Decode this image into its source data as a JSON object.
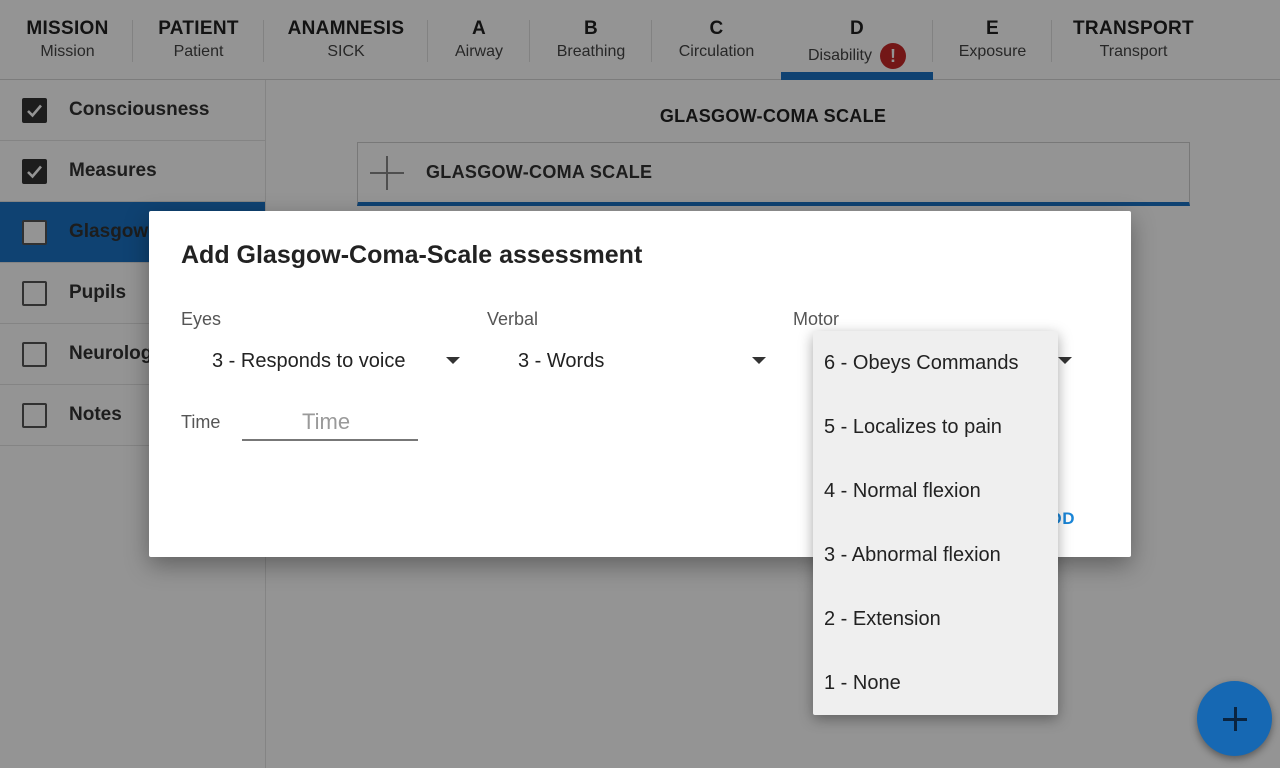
{
  "tabs": [
    {
      "title": "MISSION",
      "sub": "Mission"
    },
    {
      "title": "PATIENT",
      "sub": "Patient"
    },
    {
      "title": "ANAMNESIS",
      "sub": "SICK"
    },
    {
      "title": "A",
      "sub": "Airway"
    },
    {
      "title": "B",
      "sub": "Breathing"
    },
    {
      "title": "C",
      "sub": "Circulation"
    },
    {
      "title": "D",
      "sub": "Disability",
      "active": true,
      "error_badge": "!"
    },
    {
      "title": "E",
      "sub": "Exposure"
    },
    {
      "title": "TRANSPORT",
      "sub": "Transport"
    }
  ],
  "sidebar": {
    "items": [
      {
        "label": "Consciousness",
        "checked": true
      },
      {
        "label": "Measures",
        "checked": true
      },
      {
        "label": "Glasgow-Coma-Scale",
        "checked": false,
        "active": true
      },
      {
        "label": "Pupils",
        "checked": false
      },
      {
        "label": "Neurology",
        "checked": false
      },
      {
        "label": "Notes",
        "checked": false
      }
    ]
  },
  "main": {
    "section_title": "GLASGOW-COMA SCALE",
    "add_label": "GLASGOW-COMA SCALE"
  },
  "dialog": {
    "title": "Add Glasgow-Coma-Scale assessment",
    "eyes_label": "Eyes",
    "eyes_value": "3 - Responds to voice",
    "verbal_label": "Verbal",
    "verbal_value": "3 - Words",
    "motor_label": "Motor",
    "time_label": "Time",
    "time_placeholder": "Time",
    "add_button": "ADD"
  },
  "motor_options": [
    "6 - Obeys Commands",
    "5 - Localizes to pain",
    "4 - Normal flexion",
    "3 - Abnormal flexion",
    "2 - Extension",
    "1 - None"
  ],
  "colors": {
    "accent": "#1a73c4",
    "error": "#c62828",
    "fab": "#1668b3"
  }
}
